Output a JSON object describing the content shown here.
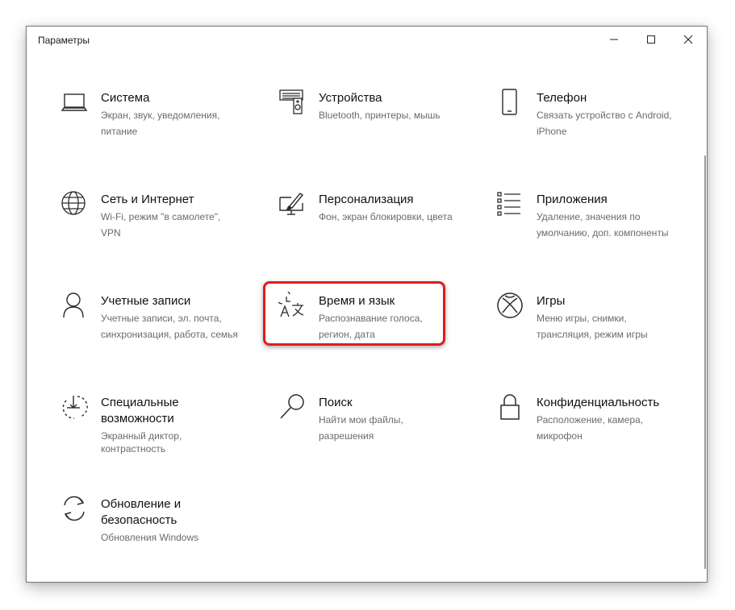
{
  "window": {
    "title": "Параметры",
    "controls": {
      "minimize_icon": "minimize-icon",
      "maximize_icon": "maximize-icon",
      "close_icon": "close-icon"
    }
  },
  "accent_color": "#e01b1b",
  "tiles": [
    {
      "id": "system",
      "icon": "laptop-icon",
      "name": "Система",
      "desc": "Экран, звук, уведомления, питание"
    },
    {
      "id": "devices",
      "icon": "devices-icon",
      "name": "Устройства",
      "desc": "Bluetooth, принтеры, мышь"
    },
    {
      "id": "phone",
      "icon": "phone-icon",
      "name": "Телефон",
      "desc": "Связать устройство с Android, iPhone"
    },
    {
      "id": "network",
      "icon": "globe-icon",
      "name": "Сеть и Интернет",
      "desc": "Wi-Fi, режим \"в самолете\", VPN"
    },
    {
      "id": "personalization",
      "icon": "paintbrush-icon",
      "name": "Персонализация",
      "desc": "Фон, экран блокировки, цвета"
    },
    {
      "id": "apps",
      "icon": "apps-list-icon",
      "name": "Приложения",
      "desc": "Удаление, значения по умолчанию, доп. компоненты"
    },
    {
      "id": "accounts",
      "icon": "person-icon",
      "name": "Учетные записи",
      "desc": "Учетные записи, эл. почта, синхронизация, работа, семья"
    },
    {
      "id": "time-language",
      "icon": "time-language-icon",
      "name": "Время и язык",
      "desc": "Распознавание голоса, регион, дата"
    },
    {
      "id": "gaming",
      "icon": "xbox-icon",
      "name": "Игры",
      "desc": "Меню игры, снимки, трансляция, режим игры"
    },
    {
      "id": "accessibility",
      "icon": "ease-of-access-icon",
      "name": "Специальные возможности",
      "desc": "Экранный диктор, контрастность"
    },
    {
      "id": "search",
      "icon": "search-icon",
      "name": "Поиск",
      "desc": "Найти мои файлы, разрешения"
    },
    {
      "id": "privacy",
      "icon": "lock-icon",
      "name": "Конфиденциальность",
      "desc": "Расположение, камера, микрофон"
    },
    {
      "id": "update",
      "icon": "sync-icon",
      "name": "Обновление и безопасность",
      "desc": "Обновления Windows"
    }
  ],
  "tile_text": {
    "system": {
      "l1": "Экран, звук, уведомления,",
      "l2": "питание"
    },
    "devices": {
      "l1": "Bluetooth, принтеры, мышь",
      "l2": ""
    },
    "phone": {
      "l1": "Связать устройство с Android,",
      "l2": "iPhone"
    },
    "network": {
      "l1": "Wi-Fi, режим \"в самолете\",",
      "l2": "VPN"
    },
    "personalization": {
      "l1": "Фон, экран блокировки, цвета",
      "l2": ""
    },
    "apps": {
      "l1": "Удаление, значения по",
      "l2": "умолчанию, доп. компоненты"
    },
    "accounts": {
      "l1": "Учетные записи, эл. почта,",
      "l2": "синхронизация, работа, семья"
    },
    "time-language": {
      "l1": "Распознавание голоса,",
      "l2": "регион, дата"
    },
    "gaming": {
      "l1": "Меню игры, снимки,",
      "l2": "трансляция, режим игры"
    },
    "accessibility": {
      "name1": "Специальные",
      "name2": "возможности",
      "l1": "Экранный диктор,",
      "l2": "контрастность"
    },
    "search": {
      "l1": "Найти мои файлы,",
      "l2": "разрешения"
    },
    "privacy": {
      "l1": "Расположение, камера,",
      "l2": "микрофон"
    },
    "update": {
      "name1": "Обновление и",
      "name2": "безопасность",
      "l1": "Обновления Windows",
      "l2": ""
    }
  }
}
